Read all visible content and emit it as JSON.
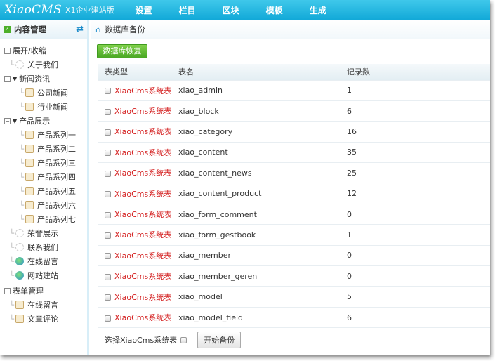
{
  "top": {
    "logo": "XiaoCMS",
    "version": "X1企业建站版",
    "nav": [
      "设置",
      "栏目",
      "区块",
      "模板",
      "生成"
    ]
  },
  "sidebar": {
    "title": "内容管理",
    "toggle": "展开/收缩",
    "items": [
      {
        "label": "关于我们",
        "level": 1,
        "icon": "gear"
      },
      {
        "label": "新闻资讯",
        "level": 0,
        "icon": "folder",
        "box": "−"
      },
      {
        "label": "公司新闻",
        "level": 2,
        "icon": "page"
      },
      {
        "label": "行业新闻",
        "level": 2,
        "icon": "page"
      },
      {
        "label": "产品展示",
        "level": 0,
        "icon": "folder",
        "box": "−"
      },
      {
        "label": "产品系列一",
        "level": 2,
        "icon": "page"
      },
      {
        "label": "产品系列二",
        "level": 2,
        "icon": "page"
      },
      {
        "label": "产品系列三",
        "level": 2,
        "icon": "page"
      },
      {
        "label": "产品系列四",
        "level": 2,
        "icon": "page"
      },
      {
        "label": "产品系列五",
        "level": 2,
        "icon": "page"
      },
      {
        "label": "产品系列六",
        "level": 2,
        "icon": "page"
      },
      {
        "label": "产品系列七",
        "level": 2,
        "icon": "page"
      },
      {
        "label": "荣誉展示",
        "level": 1,
        "icon": "gear"
      },
      {
        "label": "联系我们",
        "level": 1,
        "icon": "gear"
      },
      {
        "label": "在线留言",
        "level": 1,
        "icon": "globe"
      },
      {
        "label": "网站建站",
        "level": 1,
        "icon": "globe"
      }
    ],
    "form_section": "表单管理",
    "form_items": [
      "在线留言",
      "文章评论"
    ]
  },
  "main": {
    "breadcrumb": "数据库备份",
    "restore_button": "数据库恢复",
    "columns": [
      "表类型",
      "表名",
      "记录数"
    ],
    "rows": [
      [
        "XiaoCms系统表",
        "xiao_admin",
        "1"
      ],
      [
        "XiaoCms系统表",
        "xiao_block",
        "6"
      ],
      [
        "XiaoCms系统表",
        "xiao_category",
        "16"
      ],
      [
        "XiaoCms系统表",
        "xiao_content",
        "35"
      ],
      [
        "XiaoCms系统表",
        "xiao_content_news",
        "25"
      ],
      [
        "XiaoCms系统表",
        "xiao_content_product",
        "12"
      ],
      [
        "XiaoCms系统表",
        "xiao_form_comment",
        "0"
      ],
      [
        "XiaoCms系统表",
        "xiao_form_gestbook",
        "1"
      ],
      [
        "XiaoCms系统表",
        "xiao_member",
        "0"
      ],
      [
        "XiaoCms系统表",
        "xiao_member_geren",
        "0"
      ],
      [
        "XiaoCms系统表",
        "xiao_model",
        "5"
      ],
      [
        "XiaoCms系统表",
        "xiao_model_field",
        "6"
      ]
    ],
    "select_label": "选择XiaoCms系统表",
    "backup_button": "开始备份"
  }
}
